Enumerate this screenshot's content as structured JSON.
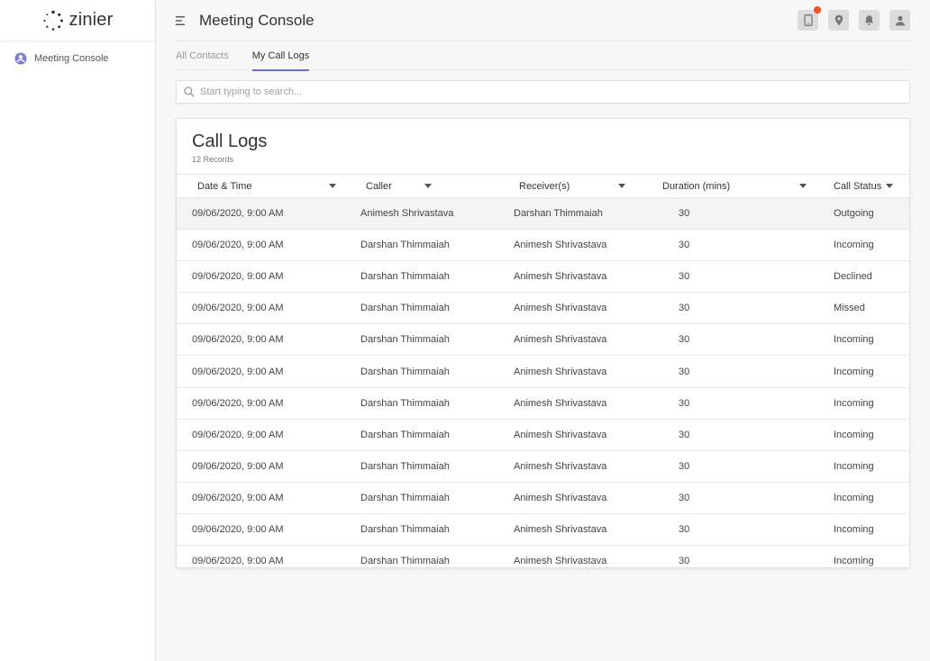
{
  "brand": {
    "name": "zinier"
  },
  "sidebar": {
    "items": [
      {
        "label": "Meeting Console",
        "icon": "user-circle-icon"
      }
    ]
  },
  "header": {
    "title": "Meeting Console",
    "accent": "#f2531d"
  },
  "tabs": [
    {
      "label": "All Contacts"
    },
    {
      "label": "My Call Logs"
    }
  ],
  "search": {
    "placeholder": "Start typing to search..."
  },
  "card": {
    "title": "Call Logs",
    "subtitle": "12 Records"
  },
  "table": {
    "columns": [
      "Date & Time",
      "Caller",
      "Receiver(s)",
      "Duration (mins)",
      "Call Status"
    ],
    "rows": [
      [
        "09/06/2020, 9:00 AM",
        "Animesh Shrivastava",
        "Darshan Thimmaiah",
        "30",
        "Outgoing"
      ],
      [
        "09/06/2020, 9:00 AM",
        "Darshan Thimmaiah",
        "Animesh Shrivastava",
        "30",
        "Incoming"
      ],
      [
        "09/06/2020, 9:00 AM",
        "Darshan Thimmaiah",
        "Animesh Shrivastava",
        "30",
        "Declined"
      ],
      [
        "09/06/2020, 9:00 AM",
        "Darshan Thimmaiah",
        "Animesh Shrivastava",
        "30",
        "Missed"
      ],
      [
        "09/06/2020, 9:00 AM",
        "Darshan Thimmaiah",
        "Animesh Shrivastava",
        "30",
        "Incoming"
      ],
      [
        "09/06/2020, 9:00 AM",
        "Darshan Thimmaiah",
        "Animesh Shrivastava",
        "30",
        "Incoming"
      ],
      [
        "09/06/2020, 9:00 AM",
        "Darshan Thimmaiah",
        "Animesh Shrivastava",
        "30",
        "Incoming"
      ],
      [
        "09/06/2020, 9:00 AM",
        "Darshan Thimmaiah",
        "Animesh Shrivastava",
        "30",
        "Incoming"
      ],
      [
        "09/06/2020, 9:00 AM",
        "Darshan Thimmaiah",
        "Animesh Shrivastava",
        "30",
        "Incoming"
      ],
      [
        "09/06/2020, 9:00 AM",
        "Darshan Thimmaiah",
        "Animesh Shrivastava",
        "30",
        "Incoming"
      ],
      [
        "09/06/2020, 9:00 AM",
        "Darshan Thimmaiah",
        "Animesh Shrivastava",
        "30",
        "Incoming"
      ],
      [
        "09/06/2020, 9:00 AM",
        "Darshan Thimmaiah",
        "Animesh Shrivastava",
        "30",
        "Incoming"
      ]
    ]
  }
}
